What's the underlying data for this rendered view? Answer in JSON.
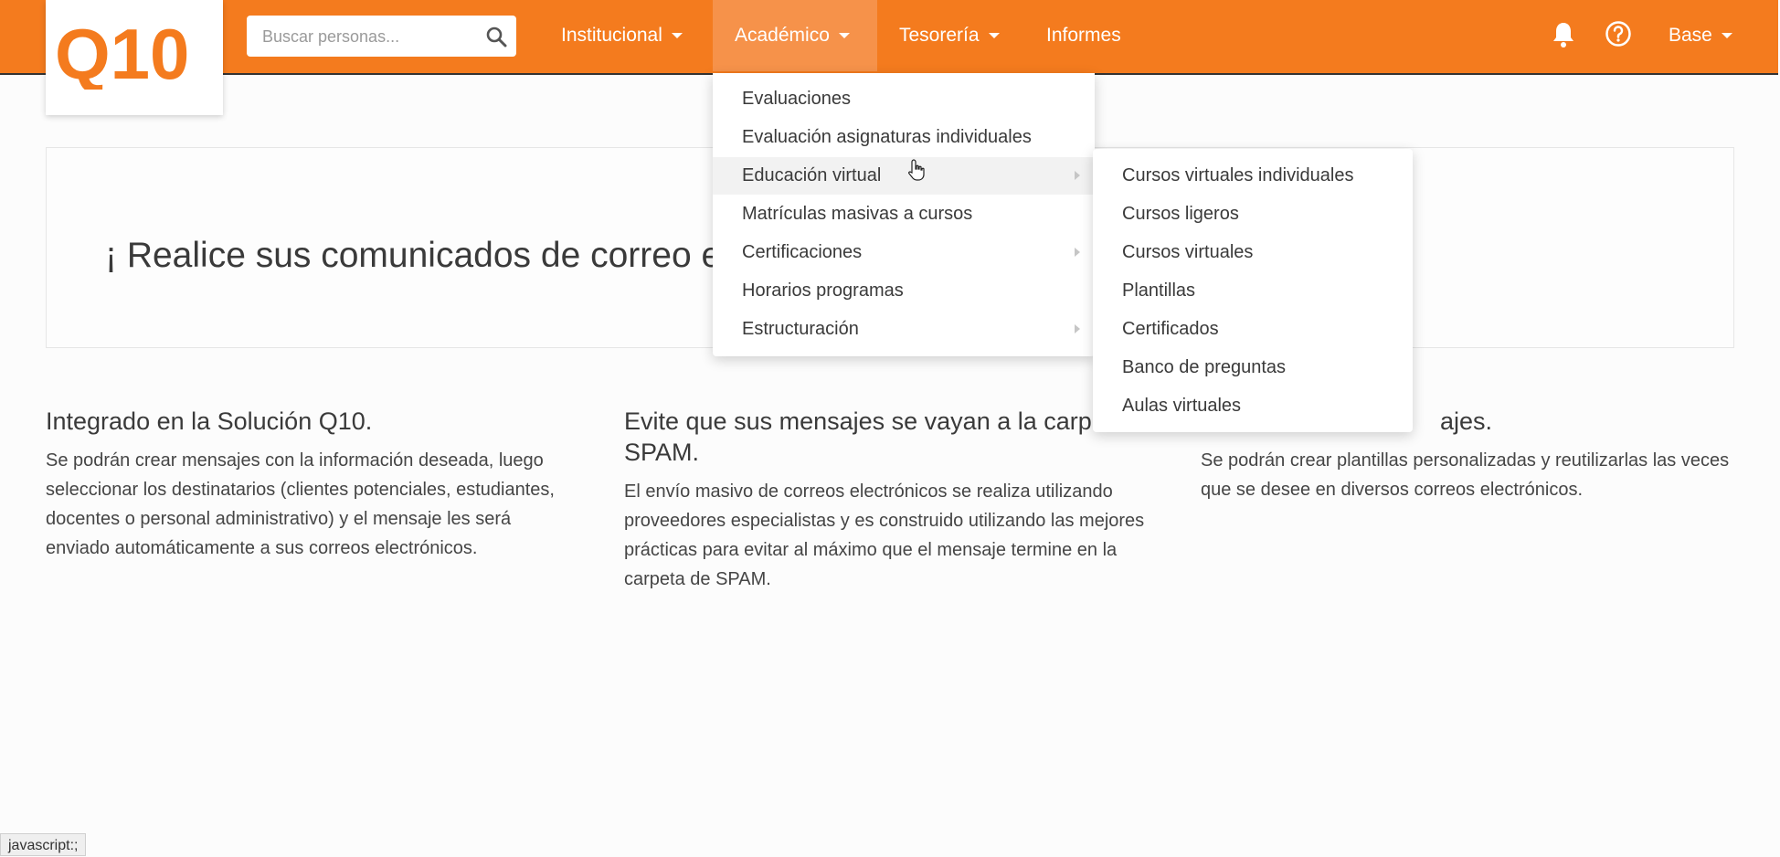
{
  "colors": {
    "brand": "#f47b1e",
    "active_nav": "#f6924a"
  },
  "logo": {
    "text": "Q10"
  },
  "search": {
    "placeholder": "Buscar personas..."
  },
  "nav": {
    "institucional": "Institucional",
    "academico": "Académico",
    "tesoreria": "Tesorería",
    "informes": "Informes",
    "base": "Base"
  },
  "banner": {
    "title": "¡ Realice sus comunicados de correo ele"
  },
  "columns": [
    {
      "title": "Integrado en la Solución Q10.",
      "body": "Se podrán crear mensajes con la información deseada, luego seleccionar los destinatarios (clientes potenciales, estudiantes, docentes o personal administrativo) y el mensaje les será enviado automáticamente a sus correos electrónicos."
    },
    {
      "title": "Evite que sus mensajes se vayan a la carp de SPAM.",
      "body": "El envío masivo de correos electrónicos se realiza utilizando proveedores especialistas y es construido utilizando las mejores prácticas para evitar al máximo que el mensaje termine en la carpeta de SPAM."
    },
    {
      "title": "ajes.",
      "body": "Se podrán crear plantillas personalizadas y reutilizarlas las veces que se desee en diversos correos electrónicos."
    }
  ],
  "academico_menu": {
    "items": [
      {
        "label": "Evaluaciones"
      },
      {
        "label": "Evaluación asignaturas individuales"
      },
      {
        "label": "Educación virtual"
      },
      {
        "label": "Matrículas masivas a cursos"
      },
      {
        "label": "Certificaciones"
      },
      {
        "label": "Horarios programas"
      },
      {
        "label": "Estructuración"
      }
    ]
  },
  "educacion_virtual_submenu": {
    "items": [
      {
        "label": "Cursos virtuales individuales"
      },
      {
        "label": "Cursos ligeros"
      },
      {
        "label": "Cursos virtuales"
      },
      {
        "label": "Plantillas"
      },
      {
        "label": "Certificados"
      },
      {
        "label": "Banco de preguntas"
      },
      {
        "label": "Aulas virtuales"
      }
    ]
  },
  "status_bar": {
    "text": "javascript:;"
  }
}
